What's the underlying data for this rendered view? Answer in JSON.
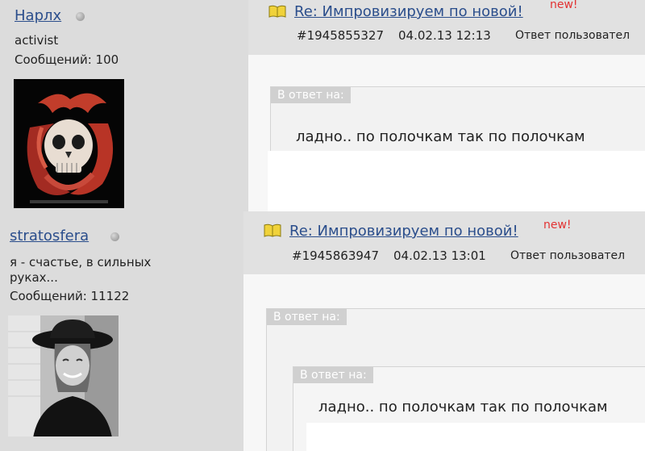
{
  "posts": [
    {
      "username": "Нарлх",
      "user_title": "activist",
      "post_count": "Сообщений: 100",
      "title": "Re: Импровизируем по новой!",
      "new_label": "new!",
      "post_number": "#1945855327",
      "date_time": "04.02.13 12:13",
      "reply_text": "Ответ пользовател",
      "quote_label": "В ответ на:",
      "quote_text": "ладно.. по полочкам так по полочкам"
    },
    {
      "username": "stratosfera",
      "user_title": "я - счастье, в сильных руках...",
      "post_count": "Сообщений: 11122",
      "title": "Re: Импровизируем по новой!",
      "new_label": "new!",
      "post_number": "#1945863947",
      "date_time": "04.02.13 13:01",
      "reply_text": "Ответ пользовател",
      "quote_label": "В ответ на:",
      "nested_quote_label": "В ответ на:",
      "quote_text": "ладно.. по полочкам так по полочкам"
    }
  ],
  "colors": {
    "link": "#2b4e8c",
    "new_badge": "#e23232",
    "sidebar_bg": "#dcdcdc",
    "header_bg": "#e1e1e1",
    "quote_label_bg": "#d0d0d0"
  },
  "icons": {
    "status": "status-dot-icon",
    "post": "book-icon",
    "avatar_1": "dragon-skull-avatar",
    "avatar_2": "woman-in-hat-avatar"
  }
}
